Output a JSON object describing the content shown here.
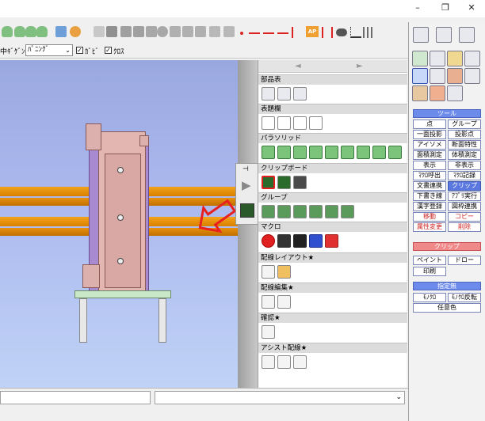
{
  "titlebar": {
    "minimize_glyph": "–",
    "restore_glyph": "❐",
    "close_glyph": "✕"
  },
  "toolbar": {
    "icons": [
      "cylinder-icon",
      "cylinder-icon",
      "cylinder-icon",
      "cylinder-icon",
      "part-icon",
      "part-icon",
      "view-icon",
      "view-icon",
      "view-icon",
      "view-icon",
      "view-icon",
      "view-icon",
      "view-icon",
      "view-icon",
      "view-icon",
      "line-icon",
      "line-icon",
      "line-icon",
      "line-icon",
      "ap-icon",
      "measure-icon",
      "grid-icon"
    ],
    "ap_label": "AP"
  },
  "options_bar": {
    "prefix_label": "中ｷﾞｹﾞﾝ",
    "combo_value": "ﾊﾟﾆﾝｸﾞ",
    "check1_label": "ｶﾞﾋﾞ",
    "check2_label": "ｸﾛｽ",
    "check_mark": "✓"
  },
  "palette": {
    "nav_left": "◄",
    "nav_right": "►",
    "sections": [
      {
        "title": "部品表"
      },
      {
        "title": "表題欄"
      },
      {
        "title": "パラソリッド"
      },
      {
        "title": "クリップボード"
      },
      {
        "title": "グループ"
      },
      {
        "title": "マクロ"
      },
      {
        "title": "配線レイアウト★"
      },
      {
        "title": "配線編集★"
      },
      {
        "title": "確認★"
      },
      {
        "title": "アシスト配線★"
      }
    ]
  },
  "flyout": {
    "pin_glyph": "⊣",
    "arrow_glyph": "▶"
  },
  "bottom": {
    "combo_value": "",
    "combo_arrow": "⌄"
  },
  "right_panel": {
    "tools_header": "ツール",
    "buttons": [
      {
        "label": "点",
        "selected": false
      },
      {
        "label": "グループ",
        "selected": false
      },
      {
        "label": "一面投影",
        "selected": false
      },
      {
        "label": "投影点",
        "selected": false
      },
      {
        "label": "アイソメ",
        "selected": false
      },
      {
        "label": "断面特性",
        "selected": false
      },
      {
        "label": "面積測定",
        "selected": false
      },
      {
        "label": "体積測定",
        "selected": false
      },
      {
        "label": "表示",
        "selected": false
      },
      {
        "label": "非表示",
        "selected": false
      },
      {
        "label": "ﾏｸﾛ呼出",
        "selected": false
      },
      {
        "label": "ﾏｸﾛ記録",
        "selected": false
      },
      {
        "label": "文書連携",
        "selected": false
      },
      {
        "label": "クリップ",
        "selected": true
      },
      {
        "label": "下書き線",
        "selected": false
      },
      {
        "label": "ｱﾌﾟﾘ実行",
        "selected": false
      },
      {
        "label": "漢字登録",
        "selected": false
      },
      {
        "label": "図枠連携",
        "selected": false
      },
      {
        "label": "移動",
        "selected": false,
        "pink": true
      },
      {
        "label": "コピー",
        "selected": false,
        "pink": true
      },
      {
        "label": "属性変更",
        "selected": false,
        "pink": true
      },
      {
        "label": "削除",
        "selected": false,
        "pink": true
      }
    ],
    "clip_header": "クリップ",
    "paint_label": "ペイント",
    "draw_label": "ドロー",
    "print_label": "印刷",
    "unspecified_header": "指定無",
    "mono_label": "ﾓﾉｸﾛ",
    "mono_invert_label": "ﾓﾉｸﾛ反転",
    "any_color_label": "任意色"
  }
}
